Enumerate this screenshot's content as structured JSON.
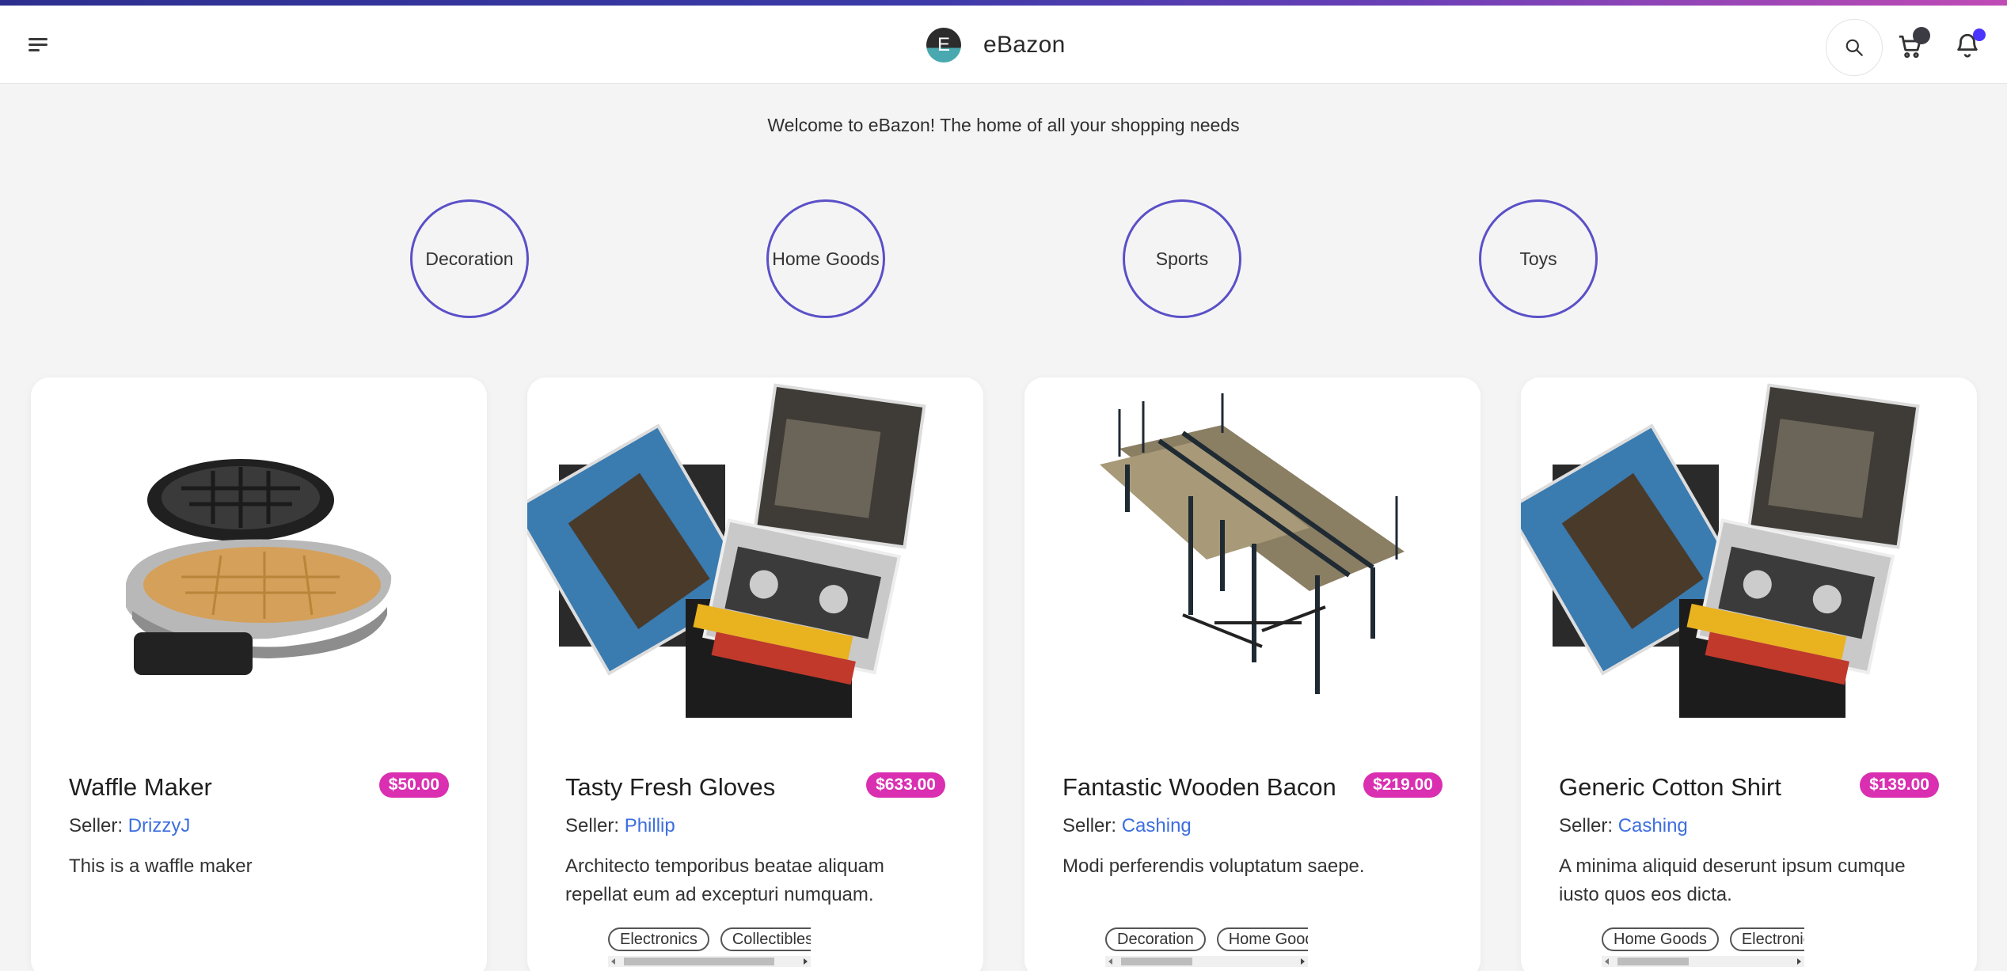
{
  "header": {
    "logo_letter": "E",
    "brand_name": "eBazon"
  },
  "welcome_text": "Welcome to eBazon! The home of all your shopping needs",
  "categories": [
    "Decoration",
    "Home Goods",
    "Sports",
    "Toys"
  ],
  "seller_prefix": "Seller: ",
  "products": [
    {
      "title": "Waffle Maker",
      "price": "$50.00",
      "seller": "DrizzyJ",
      "description": "This is a waffle maker",
      "tags": []
    },
    {
      "title": "Tasty Fresh Gloves",
      "price": "$633.00",
      "seller": "Phillip",
      "description": "Architecto temporibus beatae aliquam repellat eum ad excepturi numquam.",
      "tags": [
        "Electronics",
        "Collectibles"
      ]
    },
    {
      "title": "Fantastic Wooden Bacon",
      "price": "$219.00",
      "seller": "Cashing",
      "description": "Modi perferendis voluptatum saepe.",
      "tags": [
        "Decoration",
        "Home Goods"
      ]
    },
    {
      "title": "Generic Cotton Shirt",
      "price": "$139.00",
      "seller": "Cashing",
      "description": "A minima aliquid deserunt ipsum cumque iusto quos eos dicta.",
      "tags": [
        "Home Goods",
        "Electronics"
      ]
    }
  ],
  "colors": {
    "accent": "#5a50c8",
    "price_badge": "#d92fb0",
    "seller_link": "#3d6ee0",
    "notification_dot": "#4a35ff"
  },
  "icons": {
    "menu": "hamburger-menu-icon",
    "search": "search-icon",
    "cart": "cart-icon",
    "bell": "bell-icon"
  }
}
